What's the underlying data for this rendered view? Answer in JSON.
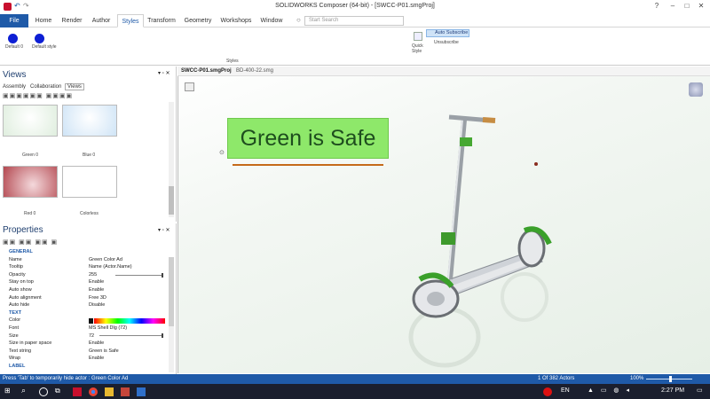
{
  "window": {
    "title": "SOLIDWORKS Composer (64-bit) - [SWCC-P01.smgProj]"
  },
  "tabs": [
    "File",
    "Home",
    "Render",
    "Author",
    "Styles",
    "Transform",
    "Geometry",
    "Workshops",
    "Window"
  ],
  "active_tab": "Styles",
  "search": {
    "placeholder": "Start Search"
  },
  "ribbon": {
    "style1": "Default 0",
    "style2": "Default style",
    "group_label": "Styles",
    "quick_style": "Quick Style",
    "auto_subscribe": "Auto Subscribe",
    "unsubscribe": "Unsubscribe"
  },
  "views_panel": {
    "title": "Views",
    "tabs": [
      "Assembly",
      "Collaboration",
      "Views"
    ],
    "thumbnails": [
      {
        "label": "Green 0",
        "color": "#dfeede"
      },
      {
        "label": "Blue 0",
        "color": "#d2e6f6"
      },
      {
        "label": "Red 0",
        "color": "#b3474f"
      },
      {
        "label": "Colorless",
        "color": "#ffffff"
      }
    ]
  },
  "properties_panel": {
    "title": "Properties",
    "rows": [
      {
        "k": "GENERAL",
        "v": "",
        "section": true
      },
      {
        "k": "Name",
        "v": "Green Color Ad"
      },
      {
        "k": "Tooltip",
        "v": "Name (Actor.Name)"
      },
      {
        "k": "Opacity",
        "v": "255"
      },
      {
        "k": "Stay on top",
        "v": "Enable"
      },
      {
        "k": "Auto show",
        "v": "Enable"
      },
      {
        "k": "Auto alignment",
        "v": "Free 3D"
      },
      {
        "k": "Auto hide",
        "v": "Disable"
      },
      {
        "k": "TEXT",
        "v": "",
        "section": true
      },
      {
        "k": "Color",
        "v": ""
      },
      {
        "k": "Font",
        "v": "MS Shell Dlg (72)"
      },
      {
        "k": "Size",
        "v": "72"
      },
      {
        "k": "Size in paper space",
        "v": "Enable"
      },
      {
        "k": "Text string",
        "v": "Green is Safe"
      },
      {
        "k": "Wrap",
        "v": "Enable"
      },
      {
        "k": "LABEL",
        "v": "",
        "section": true
      }
    ]
  },
  "document_tabs": [
    "SWCC-P01.smgProj",
    "BD-400-22.smg"
  ],
  "viewport": {
    "annotation_text": "Green is Safe",
    "accent": "#8ee86a"
  },
  "statusbar": {
    "hint": "Press 'Tab' to temporarily hide actor : Green Color Ad",
    "actors": "1 Of 382 Actors",
    "zoom": "100%"
  },
  "taskbar": {
    "lang": "EN",
    "time": "2:27 PM"
  }
}
